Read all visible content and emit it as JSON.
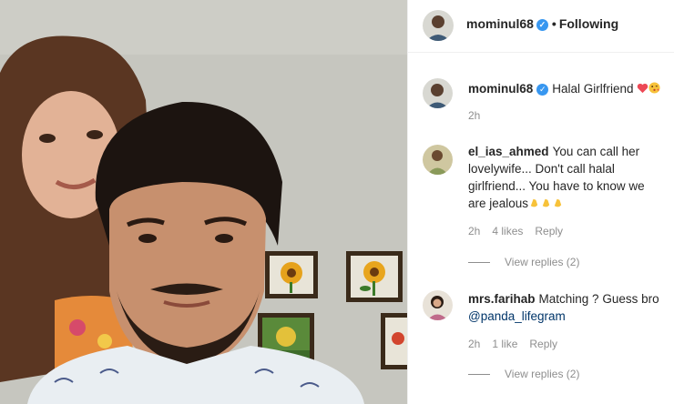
{
  "post": {
    "author": "mominul68",
    "follow_separator": "•",
    "follow_status": "Following"
  },
  "caption": {
    "username": "mominul68",
    "text": "Halal Girlfriend",
    "emojis": [
      "heart-emoji",
      "kissing-face-emoji"
    ],
    "time": "2h"
  },
  "comments": [
    {
      "username": "el_ias_ahmed",
      "text": "You can call her lovelywife... Don't call halal girlfriend... You have to know we are jealous",
      "emojis": [
        "clapping-hands-emoji",
        "clapping-hands-emoji",
        "clapping-hands-emoji"
      ],
      "time": "2h",
      "likes": "4 likes",
      "reply": "Reply",
      "view_replies": "View replies (2)"
    },
    {
      "username": "mrs.farihab",
      "text": "Matching ? Guess bro",
      "mention": "@panda_lifegram",
      "time": "2h",
      "likes": "1 like",
      "reply": "Reply",
      "view_replies": "View replies (2)"
    }
  ],
  "colors": {
    "accent_blue": "#3897f0",
    "mention": "#003569",
    "muted": "#8e8e8e",
    "heart": "#ed4956"
  }
}
